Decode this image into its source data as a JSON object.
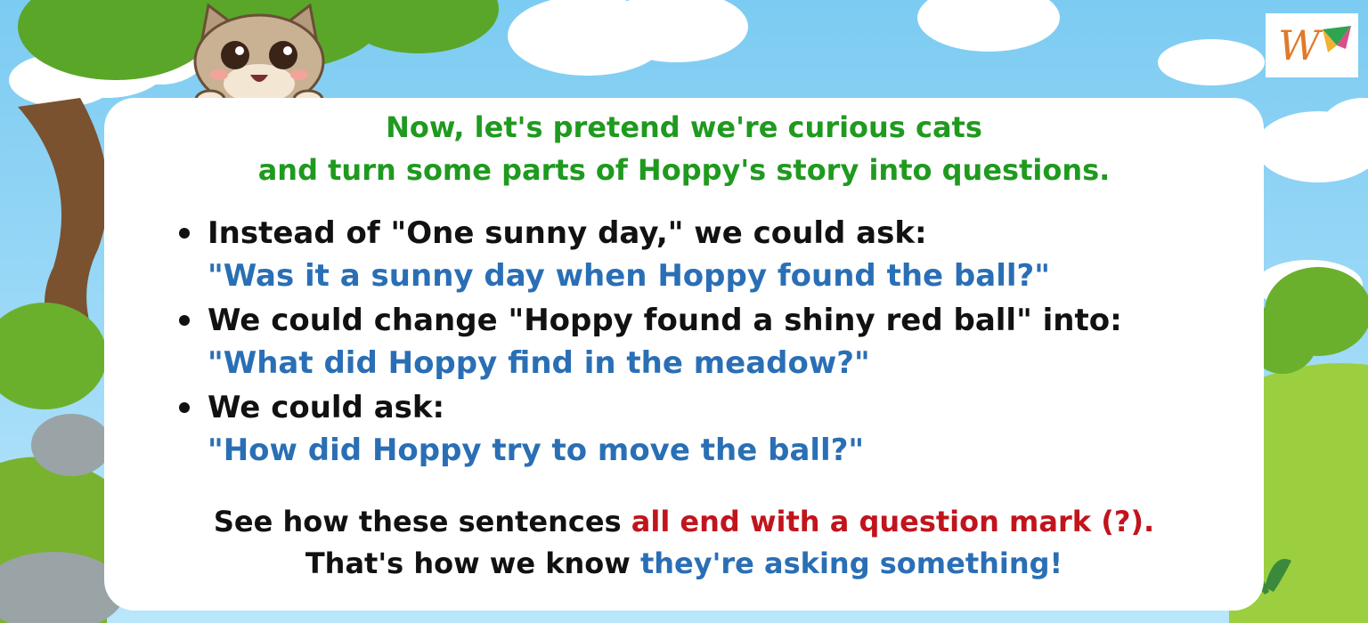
{
  "colors": {
    "heading": "#1f9a1f",
    "body": "#111111",
    "question": "#2a6fb5",
    "emphasis_red": "#c2141c",
    "sky": "#8fd3f5",
    "grass": "#8cc63f",
    "card": "#ffffff"
  },
  "heading": {
    "line1": "Now, let's pretend we're curious cats",
    "line2": "and turn some parts of Hoppy's story into questions."
  },
  "bullets": [
    {
      "statement": "Instead of \"One sunny day,\" we could ask:",
      "question": "\"Was it a sunny day when Hoppy found the ball?\""
    },
    {
      "statement": "We could change \"Hoppy found a shiny red ball\" into:",
      "question": "\"What did Hoppy find in the meadow?\""
    },
    {
      "statement": "We could ask:",
      "question": "\"How did Hoppy try to move the ball?\""
    }
  ],
  "footer": {
    "line1_prefix": "See how these sentences ",
    "line1_highlight": "all end with a question mark (?).",
    "line2_prefix": "That's how we know ",
    "line2_highlight": "they're asking something!"
  },
  "icons": {
    "mascot": "cat-peeking-icon",
    "logo": "w-kite-logo-icon"
  }
}
